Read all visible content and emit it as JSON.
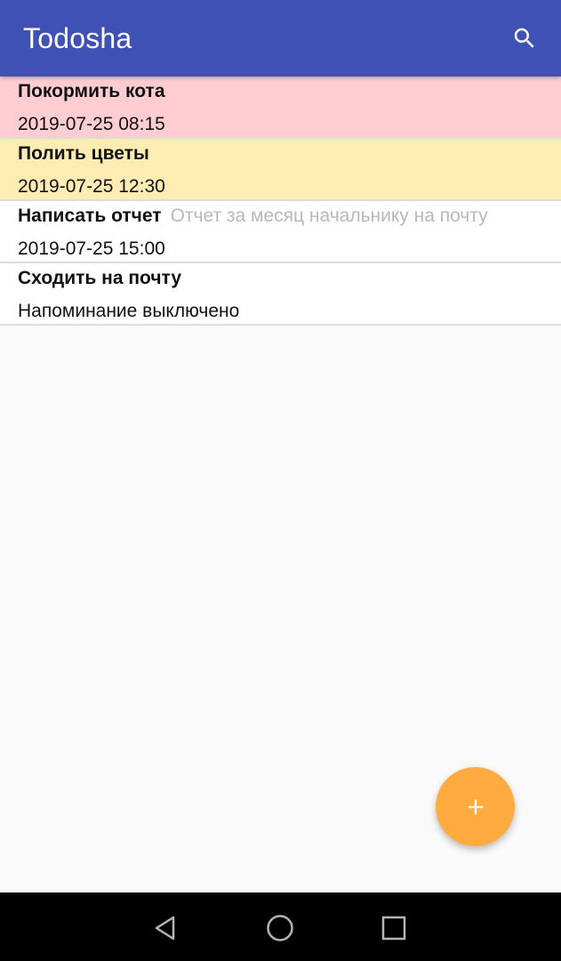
{
  "app": {
    "title": "Todosha"
  },
  "colors": {
    "primary": "#3f51b5",
    "accent": "#ffab40",
    "overdue_bg": "#ffcdd2",
    "soon_bg": "#ffecb3",
    "normal_bg": "#ffffff"
  },
  "toolbar": {
    "search_icon": "search-icon"
  },
  "tasks": [
    {
      "title": "Покормить кота",
      "description": "",
      "time": "2019-07-25 08:15",
      "status": "overdue"
    },
    {
      "title": "Полить цветы",
      "description": "",
      "time": "2019-07-25 12:30",
      "status": "soon"
    },
    {
      "title": "Написать отчет",
      "description": "Отчет за месяц начальнику на почту",
      "time": "2019-07-25 15:00",
      "status": "normal"
    },
    {
      "title": "Сходить на почту",
      "description": "",
      "time": "Напоминание выключено",
      "status": "normal"
    }
  ],
  "fab": {
    "icon": "plus-icon"
  },
  "navigation": {
    "back_icon": "back-icon",
    "home_icon": "home-icon",
    "recents_icon": "recents-icon"
  }
}
